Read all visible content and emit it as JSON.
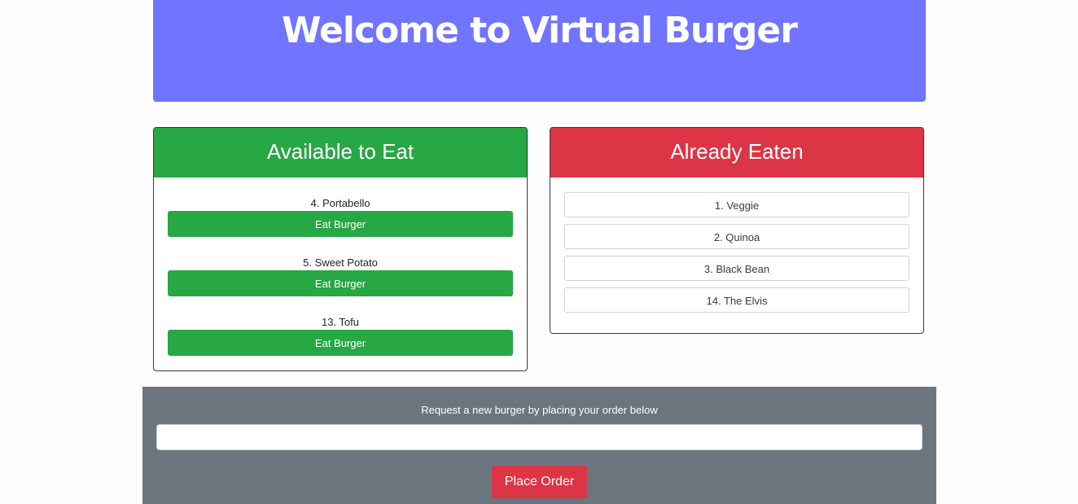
{
  "header": {
    "title": "Welcome to Virtual Burger"
  },
  "available": {
    "title": "Available to Eat",
    "items": [
      {
        "name": "4. Portabello",
        "button": "Eat Burger"
      },
      {
        "name": "5. Sweet Potato",
        "button": "Eat Burger"
      },
      {
        "name": "13. Tofu",
        "button": "Eat Burger"
      }
    ]
  },
  "eaten": {
    "title": "Already Eaten",
    "items": [
      "1. Veggie",
      "2. Quinoa",
      "3. Black Bean",
      "14. The Elvis"
    ]
  },
  "order": {
    "prompt": "Request a new burger by placing your order below",
    "input_value": "",
    "button": "Place Order"
  },
  "colors": {
    "header_bg": "#7174ff",
    "available": "#28a745",
    "eaten": "#dc3545",
    "order_bg": "#6c757d"
  }
}
